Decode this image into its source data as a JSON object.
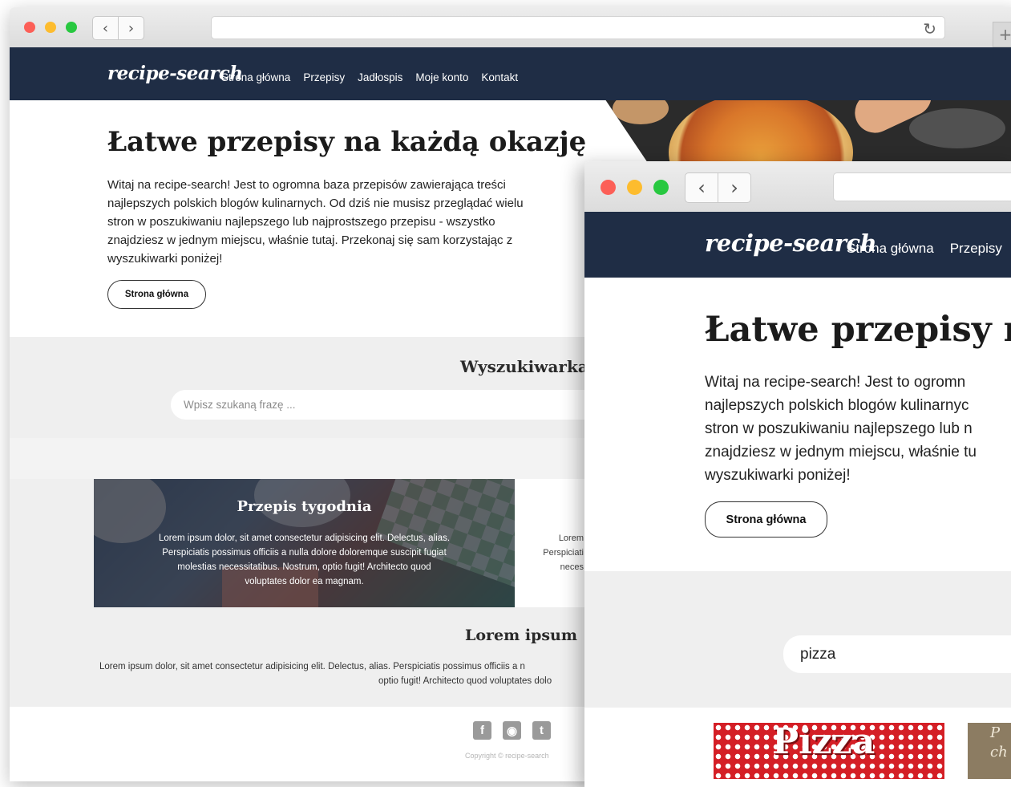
{
  "site": {
    "logo": "recipe-search",
    "menu": [
      "Strona główna",
      "Przepisy",
      "Jadłospis",
      "Moje konto",
      "Kontakt"
    ]
  },
  "window1": {
    "hero": {
      "title": "Łatwe przepisy na każdą okazję",
      "intro_lines": [
        "Witaj na recipe-search! Jest to ogromna baza przepisów zawierająca treści",
        "najlepszych polskich blogów kulinarnych. Od dziś nie musisz przeglądać wielu",
        "stron w poszukiwaniu najlepszego lub najprostszego przepisu - wszystko",
        "znajdziesz w jednym miejscu, właśnie tutaj. Przekonaj się sam korzystając z",
        "wyszukiwarki poniżej!"
      ],
      "button": "Strona główna"
    },
    "search": {
      "title": "Wyszukiwarka",
      "placeholder": "Wpisz szukaną frazę ..."
    },
    "featured": {
      "title": "Przepis tygodnia",
      "lines": [
        "Lorem ipsum dolor, sit amet consectetur adipisicing elit. Delectus, alias.",
        "Perspiciatis possimus officiis a nulla dolore doloremque suscipit fugiat",
        "molestias necessitatibus. Nostrum, optio fugit! Architecto quod",
        "voluptates dolor ea magnam."
      ]
    },
    "side_lines": [
      "Lorem",
      "Perspiciati",
      "neces"
    ],
    "lorem_section": {
      "title": "Lorem ipsum",
      "lines": [
        "Lorem ipsum dolor, sit amet consectetur adipisicing elit. Delectus, alias. Perspiciatis possimus officiis a n",
        "optio fugit! Architecto quod voluptates dolo"
      ]
    },
    "footer": {
      "social_icons": [
        "facebook-icon",
        "instagram-icon",
        "twitter-icon"
      ],
      "copyright": "Copyright © recipe-search"
    }
  },
  "window2": {
    "menu_visible": [
      "Strona główna",
      "Przepisy"
    ],
    "hero": {
      "title": "Łatwe przepisy na l",
      "intro_lines": [
        "Witaj na recipe-search! Jest to ogromn",
        "najlepszych polskich blogów kulinarnyc",
        "stron w poszukiwaniu najlepszego lub n",
        "znajdziesz w jednym miejscu, właśnie tu",
        "wyszukiwarki poniżej!"
      ],
      "button": "Strona główna"
    },
    "search_value": "pizza",
    "results": [
      {
        "label": "Pizza"
      },
      {
        "label_lines": [
          "P",
          "ch"
        ]
      }
    ]
  }
}
